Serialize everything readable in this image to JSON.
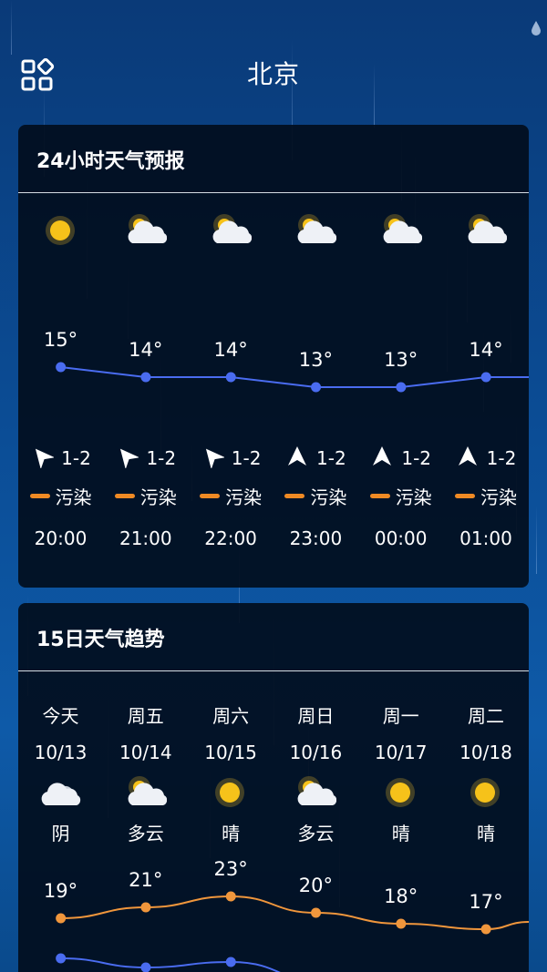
{
  "header": {
    "city": "北京",
    "menu_icon": "apps-grid-icon"
  },
  "hourly": {
    "title": "24小时天气预报",
    "items": [
      {
        "icon": "sun-icon",
        "temp": "15°",
        "temp_value": 15,
        "wind_dir": "northwest",
        "wind": "1-2",
        "aqi_color": "#f08a24",
        "aqi": "污染",
        "time": "20:00"
      },
      {
        "icon": "partly-cloudy-icon",
        "temp": "14°",
        "temp_value": 14,
        "wind_dir": "northwest",
        "wind": "1-2",
        "aqi_color": "#f08a24",
        "aqi": "污染",
        "time": "21:00"
      },
      {
        "icon": "partly-cloudy-icon",
        "temp": "14°",
        "temp_value": 14,
        "wind_dir": "northwest",
        "wind": "1-2",
        "aqi_color": "#f08a24",
        "aqi": "污染",
        "time": "22:00"
      },
      {
        "icon": "partly-cloudy-icon",
        "temp": "13°",
        "temp_value": 13,
        "wind_dir": "north",
        "wind": "1-2",
        "aqi_color": "#f08a24",
        "aqi": "污染",
        "time": "23:00"
      },
      {
        "icon": "partly-cloudy-icon",
        "temp": "13°",
        "temp_value": 13,
        "wind_dir": "north",
        "wind": "1-2",
        "aqi_color": "#f08a24",
        "aqi": "污染",
        "time": "00:00"
      },
      {
        "icon": "partly-cloudy-icon",
        "temp": "14°",
        "temp_value": 14,
        "wind_dir": "north",
        "wind": "1-2",
        "aqi_color": "#f08a24",
        "aqi": "污染",
        "time": "01:00"
      }
    ],
    "line_color": "#4a6cf0"
  },
  "daily": {
    "title": "15日天气趋势",
    "items": [
      {
        "week": "今天",
        "date": "10/13",
        "icon": "cloudy-icon",
        "cond": "阴",
        "high": "19°",
        "high_value": 19,
        "low_value": 9
      },
      {
        "week": "周五",
        "date": "10/14",
        "icon": "partly-cloudy-icon",
        "cond": "多云",
        "high": "21°",
        "high_value": 21,
        "low_value": 8
      },
      {
        "week": "周六",
        "date": "10/15",
        "icon": "sun-icon",
        "cond": "晴",
        "high": "23°",
        "high_value": 23,
        "low_value": 8.6
      },
      {
        "week": "周日",
        "date": "10/16",
        "icon": "partly-cloudy-icon",
        "cond": "多云",
        "high": "20°",
        "high_value": 20,
        "low_value": null
      },
      {
        "week": "周一",
        "date": "10/17",
        "icon": "sun-icon",
        "cond": "晴",
        "high": "18°",
        "high_value": 18,
        "low_value": null
      },
      {
        "week": "周二",
        "date": "10/18",
        "icon": "sun-icon",
        "cond": "晴",
        "high": "17°",
        "high_value": 17,
        "low_value": null
      }
    ],
    "high_color": "#f0963c",
    "low_color": "#4a6cf0"
  }
}
